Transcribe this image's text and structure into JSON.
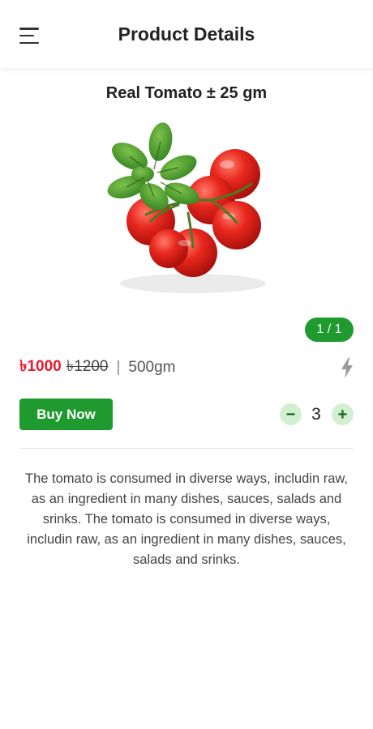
{
  "header": {
    "title": "Product Details",
    "menu_icon": "hamburger-menu-icon"
  },
  "product": {
    "name": "Real Tomato ± 25 gm",
    "image_counter": "1 / 1",
    "price_current": "৳1000",
    "price_old": "৳1200",
    "separator": "|",
    "weight": "500gm",
    "flash_icon": "lightning-bolt-icon",
    "buy_label": "Buy Now",
    "quantity": "3",
    "minus_symbol": "−",
    "plus_symbol": "+",
    "description": "The tomato is consumed in diverse ways, includin raw, as an ingredient in many dishes, sauces, salads and srinks. The tomato is consumed in diverse ways, includin raw, as an ingredient in many dishes, sauces, salads and srinks."
  },
  "colors": {
    "brand_green": "#1f9a2f",
    "price_red": "#e8192c",
    "qty_button_bg": "#d2efd2"
  }
}
